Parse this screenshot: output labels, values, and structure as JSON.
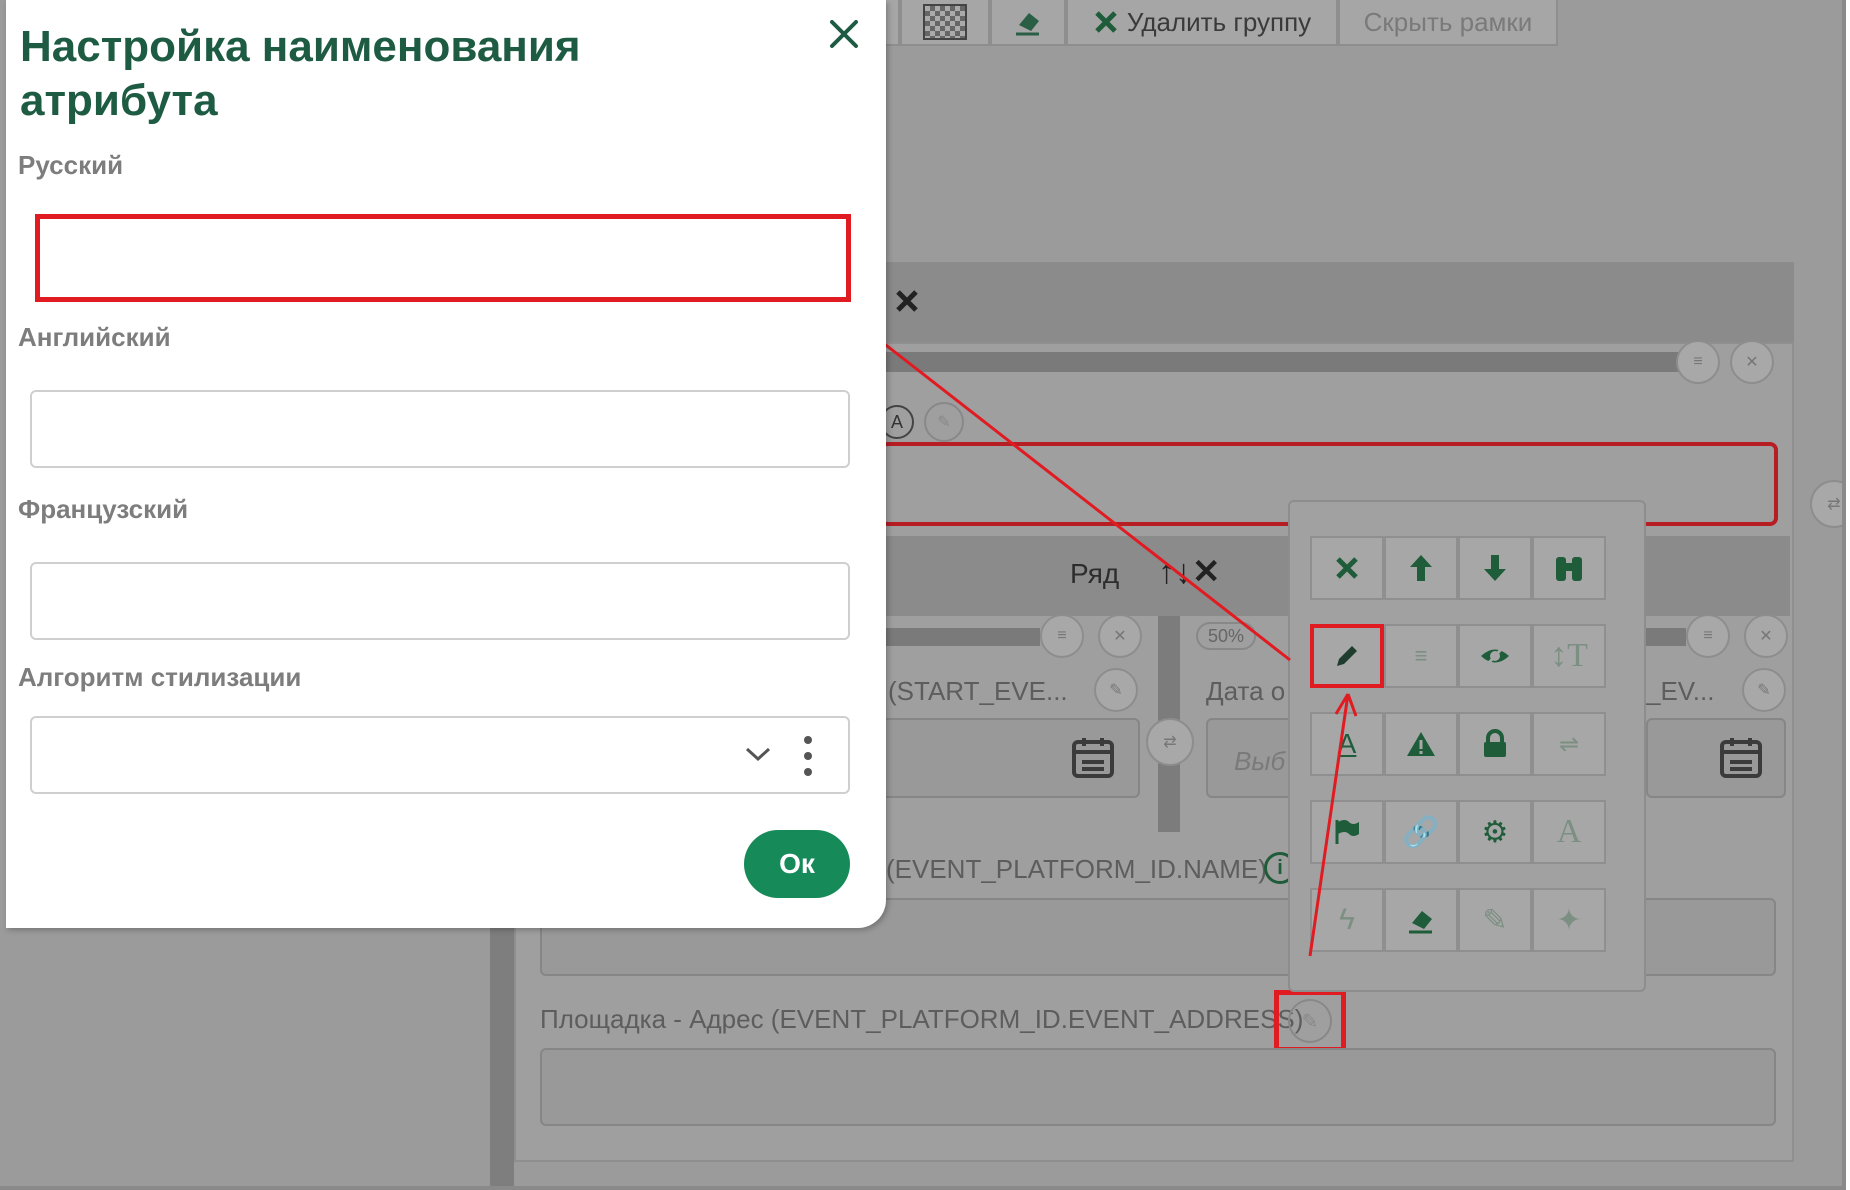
{
  "toolbar": {
    "delete_group": "Удалить группу",
    "hide_frames": "Скрыть рамки"
  },
  "modal": {
    "title": "Настройка наименования атрибута",
    "fields": [
      {
        "label": "Русский",
        "value": ""
      },
      {
        "label": "Английский",
        "value": ""
      },
      {
        "label": "Французский",
        "value": ""
      }
    ],
    "style_algorithm_label": "Алгоритм стилизации",
    "style_algorithm_value": "",
    "ok_label": "Ок"
  },
  "background": {
    "row_label": "Ряд",
    "start_event_field": "(START_EVE...",
    "percent_badge": "50%",
    "date_label": "Дата о",
    "select_placeholder": "Выб",
    "ev_field": "_EV...",
    "platform_name": "(EVENT_PLATFORM_ID.NAME)",
    "platform_address": "Площадка - Адрес (EVENT_PLATFORM_ID.EVENT_ADDRESS)"
  },
  "tools": [
    "delete-icon",
    "arrow-up-icon",
    "arrow-down-icon",
    "binoculars-icon",
    "pencil-icon",
    "list-icon",
    "eye-slash-icon",
    "text-height-icon",
    "text-underline-icon",
    "warning-icon",
    "lock-icon",
    "wrap-text-icon",
    "flag-icon",
    "link-icon",
    "gear-icon",
    "font-icon",
    "bolt-icon",
    "eraser-icon",
    "edit-pen-icon",
    "magic-wand-icon"
  ],
  "colors": {
    "brand_green": "#1e5b43",
    "button_green": "#178a5a",
    "highlight_red": "#e11b22"
  }
}
